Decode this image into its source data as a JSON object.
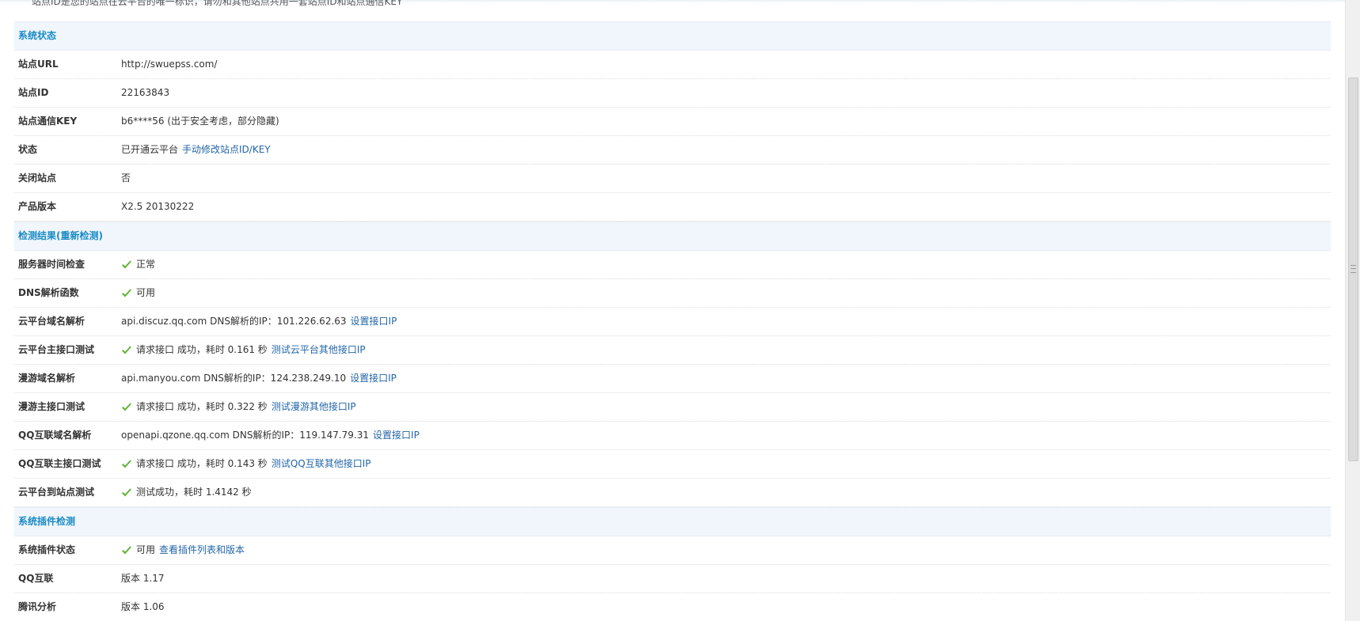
{
  "top_note": "站点ID是您的站点在云平台的唯一标识，请勿和其他站点共用一套站点ID和站点通信KEY",
  "colors": {
    "section_header_bg": "#f0f6fb",
    "section_header_text": "#1a8bc5",
    "link": "#2366a8",
    "check": "#5cb531"
  },
  "sections": {
    "status": {
      "title": "系统状态",
      "rows": {
        "url": {
          "label": "站点URL",
          "value": "http://swuepss.com/"
        },
        "id": {
          "label": "站点ID",
          "value": "22163843"
        },
        "key": {
          "label": "站点通信KEY",
          "value": "b6****56 (出于安全考虑，部分隐藏)"
        },
        "state": {
          "label": "状态",
          "value": "已开通云平台",
          "link": "手动修改站点ID/KEY"
        },
        "closed": {
          "label": "关闭站点",
          "value": "否"
        },
        "version": {
          "label": "产品版本",
          "value": "X2.5 20130222"
        }
      }
    },
    "check": {
      "title": "检测结果(重新检测)",
      "rows": {
        "time": {
          "label": "服务器时间检查",
          "value": "正常"
        },
        "dns": {
          "label": "DNS解析函数",
          "value": "可用"
        },
        "cloud_dns": {
          "label": "云平台域名解析",
          "value": "api.discuz.qq.com DNS解析的IP：101.226.62.63",
          "link": "设置接口IP"
        },
        "cloud_api": {
          "label": "云平台主接口测试",
          "value": "请求接口 成功，耗时 0.161 秒",
          "link": "测试云平台其他接口IP"
        },
        "manyou_dns": {
          "label": "漫游域名解析",
          "value": "api.manyou.com DNS解析的IP：124.238.249.10",
          "link": "设置接口IP"
        },
        "manyou_api": {
          "label": "漫游主接口测试",
          "value": "请求接口 成功，耗时 0.322 秒",
          "link": "测试漫游其他接口IP"
        },
        "qq_dns": {
          "label": "QQ互联域名解析",
          "value": "openapi.qzone.qq.com DNS解析的IP：119.147.79.31",
          "link": "设置接口IP"
        },
        "qq_api": {
          "label": "QQ互联主接口测试",
          "value": "请求接口 成功，耗时 0.143 秒",
          "link": "测试QQ互联其他接口IP"
        },
        "cloud_site": {
          "label": "云平台到站点测试",
          "value": "测试成功，耗时 1.4142 秒"
        }
      }
    },
    "plugins": {
      "title": "系统插件检测",
      "rows": {
        "plugin_state": {
          "label": "系统插件状态",
          "value": "可用",
          "link": "查看插件列表和版本"
        },
        "qq_connect": {
          "label": "QQ互联",
          "value": "版本 1.17"
        },
        "tencent_stats": {
          "label": "腾讯分析",
          "value": "版本 1.06"
        }
      }
    }
  }
}
